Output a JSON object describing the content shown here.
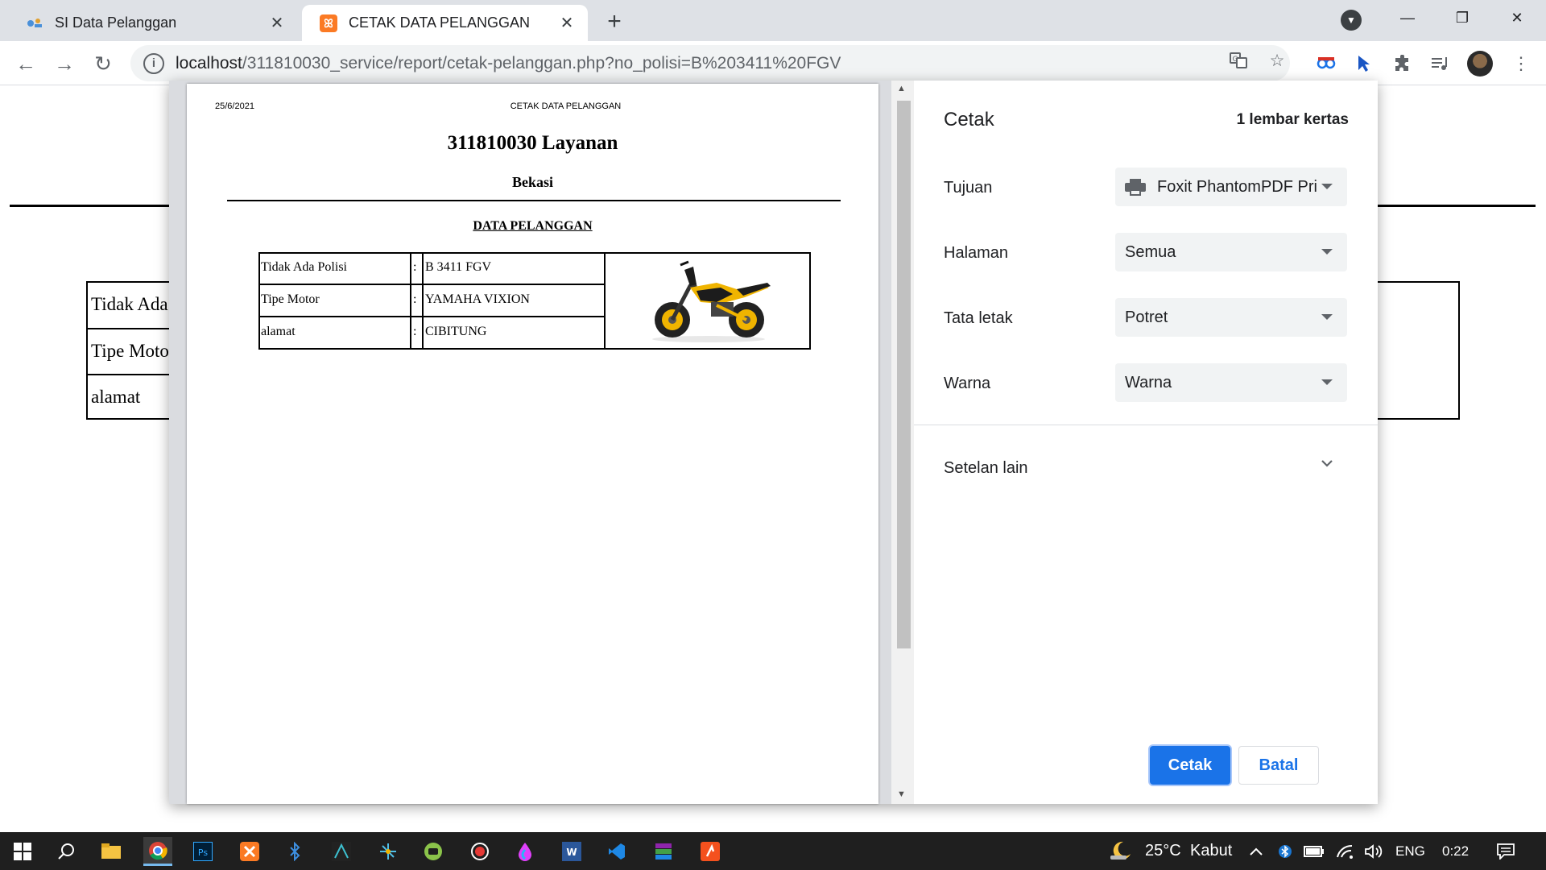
{
  "browser": {
    "tabs": [
      {
        "title": "SI Data Pelanggan",
        "active": false
      },
      {
        "title": "CETAK DATA PELANGGAN",
        "active": true
      }
    ],
    "url_host": "localhost",
    "url_path": "/311810030_service/report/cetak-pelanggan.php?no_polisi=B%203411%20FGV"
  },
  "background_page": {
    "rows": [
      "Tidak Ada",
      "Tipe Moto",
      "alamat"
    ]
  },
  "preview": {
    "date": "25/6/2021",
    "header": "CETAK DATA PELANGGAN",
    "title": "311810030 Layanan",
    "city": "Bekasi",
    "section": "DATA PELANGGAN",
    "separator": ":",
    "rows": [
      {
        "label": "Tidak Ada Polisi",
        "value": "B 3411 FGV"
      },
      {
        "label": "Tipe Motor",
        "value": "YAMAHA VIXION"
      },
      {
        "label": "alamat",
        "value": "CIBITUNG"
      }
    ]
  },
  "print_settings": {
    "title": "Cetak",
    "sheets": "1 lembar kertas",
    "destination": {
      "label": "Tujuan",
      "value": "Foxit PhantomPDF Pri"
    },
    "pages": {
      "label": "Halaman",
      "value": "Semua"
    },
    "layout": {
      "label": "Tata letak",
      "value": "Potret"
    },
    "color": {
      "label": "Warna",
      "value": "Warna"
    },
    "more_settings": "Setelan lain",
    "print_button": "Cetak",
    "cancel_button": "Batal"
  },
  "taskbar": {
    "weather": "25°C",
    "weather_text": "Kabut",
    "language": "ENG",
    "time": "0:22"
  },
  "colors": {
    "accent": "#1a73e8",
    "taskbar": "#1f1f1f",
    "tabstrip": "#dee1e6"
  }
}
